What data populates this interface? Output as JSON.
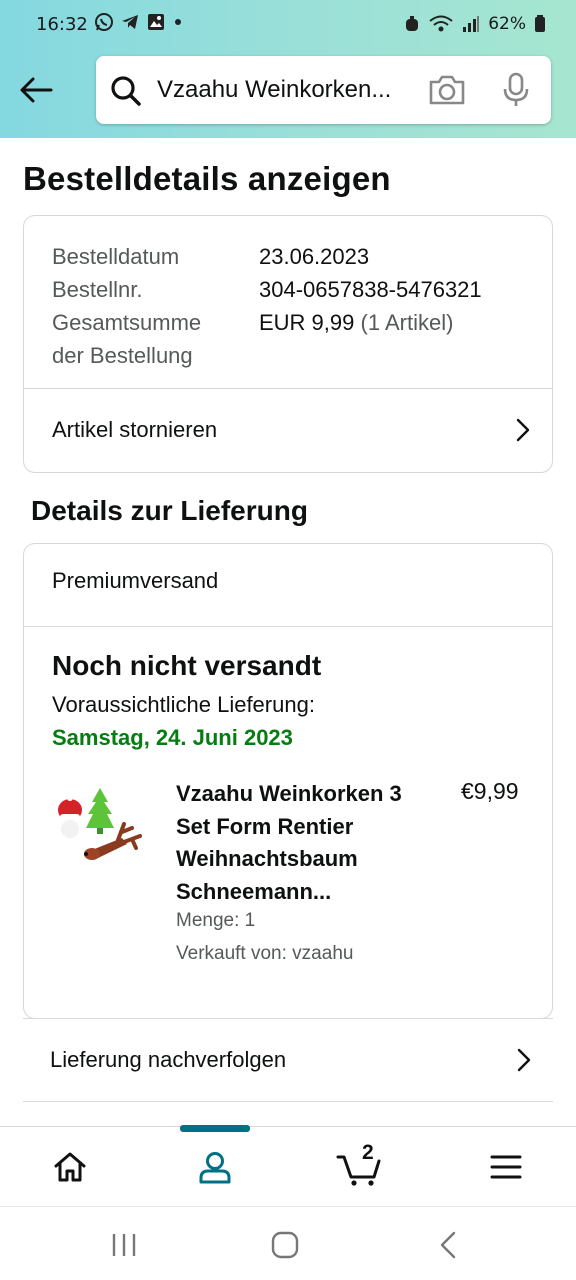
{
  "status_bar": {
    "time": "16:32",
    "battery": "62%"
  },
  "search": {
    "query": "Vzaahu Weinkorken..."
  },
  "page_title": "Bestelldetails anzeigen",
  "order": {
    "date_label": "Bestelldatum",
    "date_value": "23.06.2023",
    "number_label": "Bestellnr.",
    "number_value": "304-0657838-5476321",
    "total_label_1": "Gesamtsumme",
    "total_label_2": "der Bestellung",
    "total_value": "EUR 9,99",
    "total_items": "(1 Artikel)",
    "cancel_label": "Artikel stornieren"
  },
  "delivery": {
    "section_title": "Details zur Lieferung",
    "shipping_method": "Premiumversand",
    "status": "Noch nicht versandt",
    "expected_label": "Voraussichtliche Lieferung:",
    "expected_date": "Samstag, 24. Juni 2023",
    "item": {
      "name": "Vzaahu Weinkorken 3 Set Form Rentier Weihnachtsbaum Schneemann...",
      "price": "€9,99",
      "quantity": "Menge: 1",
      "seller": "Verkauft von: vzaahu"
    },
    "track_label": "Lieferung nachverfolgen"
  },
  "bottom_nav": {
    "cart_count": "2",
    "items": [
      "home-icon",
      "account-icon",
      "cart-icon",
      "menu-icon"
    ],
    "active": "account-icon"
  },
  "colors": {
    "accent": "#007185",
    "delivery_green": "#067d11",
    "header_gradient_start": "#84d8e0",
    "header_gradient_end": "#a6e6d0"
  }
}
